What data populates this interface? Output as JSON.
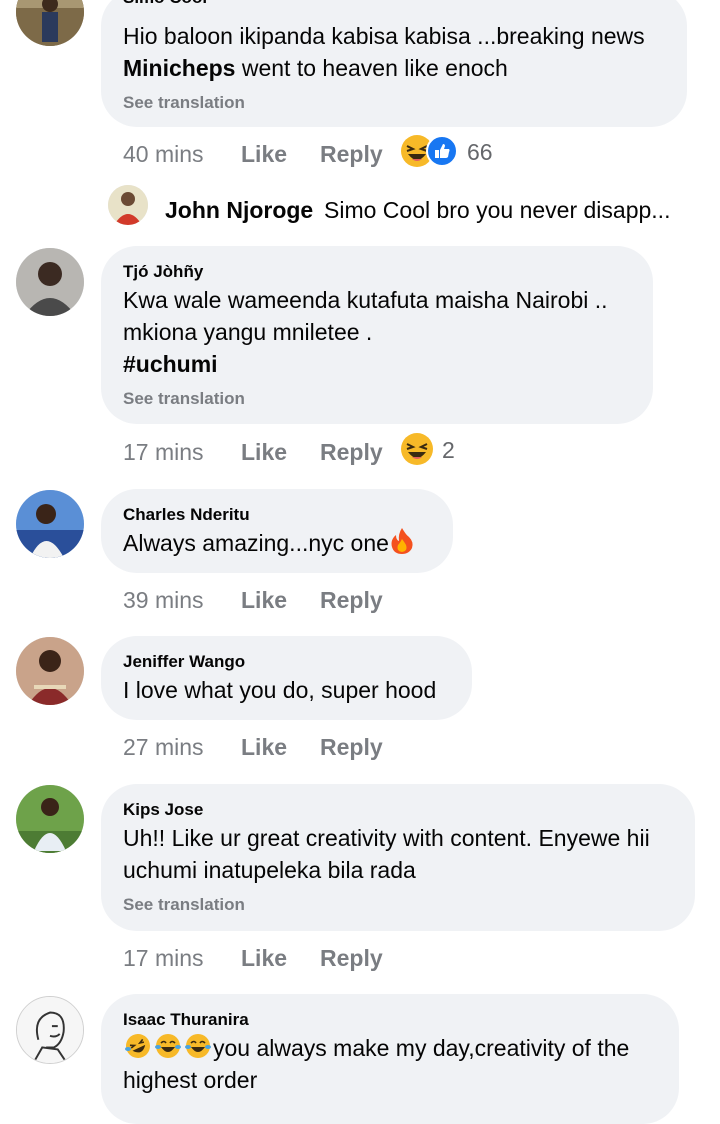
{
  "comments": [
    {
      "author": "Simo Cool",
      "line1": "Hio baloon ikipanda kabisa kabisa ...breaking news",
      "line2_bold": "Minicheps",
      "line2_rest": " went to heaven like enoch",
      "see_translation": "See translation",
      "time": "40 mins",
      "like": "Like",
      "reply": "Reply",
      "reaction_count": "66"
    },
    {
      "author": "Tjó Jòhñy",
      "line1": "Kwa wale wameenda kutafuta maisha Nairobi ..",
      "line2": "mkiona yangu mniletee .",
      "line3": "#uchumi",
      "see_translation": "See translation",
      "time": "17 mins",
      "like": "Like",
      "reply": "Reply",
      "reaction_count": "2"
    },
    {
      "author": "Charles Nderitu",
      "line1": "Always amazing...nyc one",
      "time": "39 mins",
      "like": "Like",
      "reply": "Reply"
    },
    {
      "author": "Jeniffer Wango",
      "line1": "I love what you do, super hood",
      "time": "27 mins",
      "like": "Like",
      "reply": "Reply"
    },
    {
      "author": "Kips Jose",
      "line1": "Uh!! Like ur great creativity with content. Enyewe hii",
      "line2": "uchumi inatupeleka bila rada",
      "see_translation": "See translation",
      "time": "17 mins",
      "like": "Like",
      "reply": "Reply"
    },
    {
      "author": "Isaac Thuranira",
      "line1": "you always make my day,creativity of the",
      "line2": "highest order"
    }
  ],
  "reply_preview": {
    "author": "John Njoroge",
    "text": "Simo Cool bro you never disapp...",
    "ellipsis": "..."
  },
  "colors": {
    "bubble": "#f0f2f5",
    "meta": "#7a7d82",
    "like_blue": "#1877f2",
    "haha_yellow": "#f7b928"
  },
  "icons": [
    "haha-reaction-icon",
    "like-reaction-icon",
    "fire-emoji-icon",
    "rofl-emoji-icon",
    "joy-emoji-icon"
  ]
}
